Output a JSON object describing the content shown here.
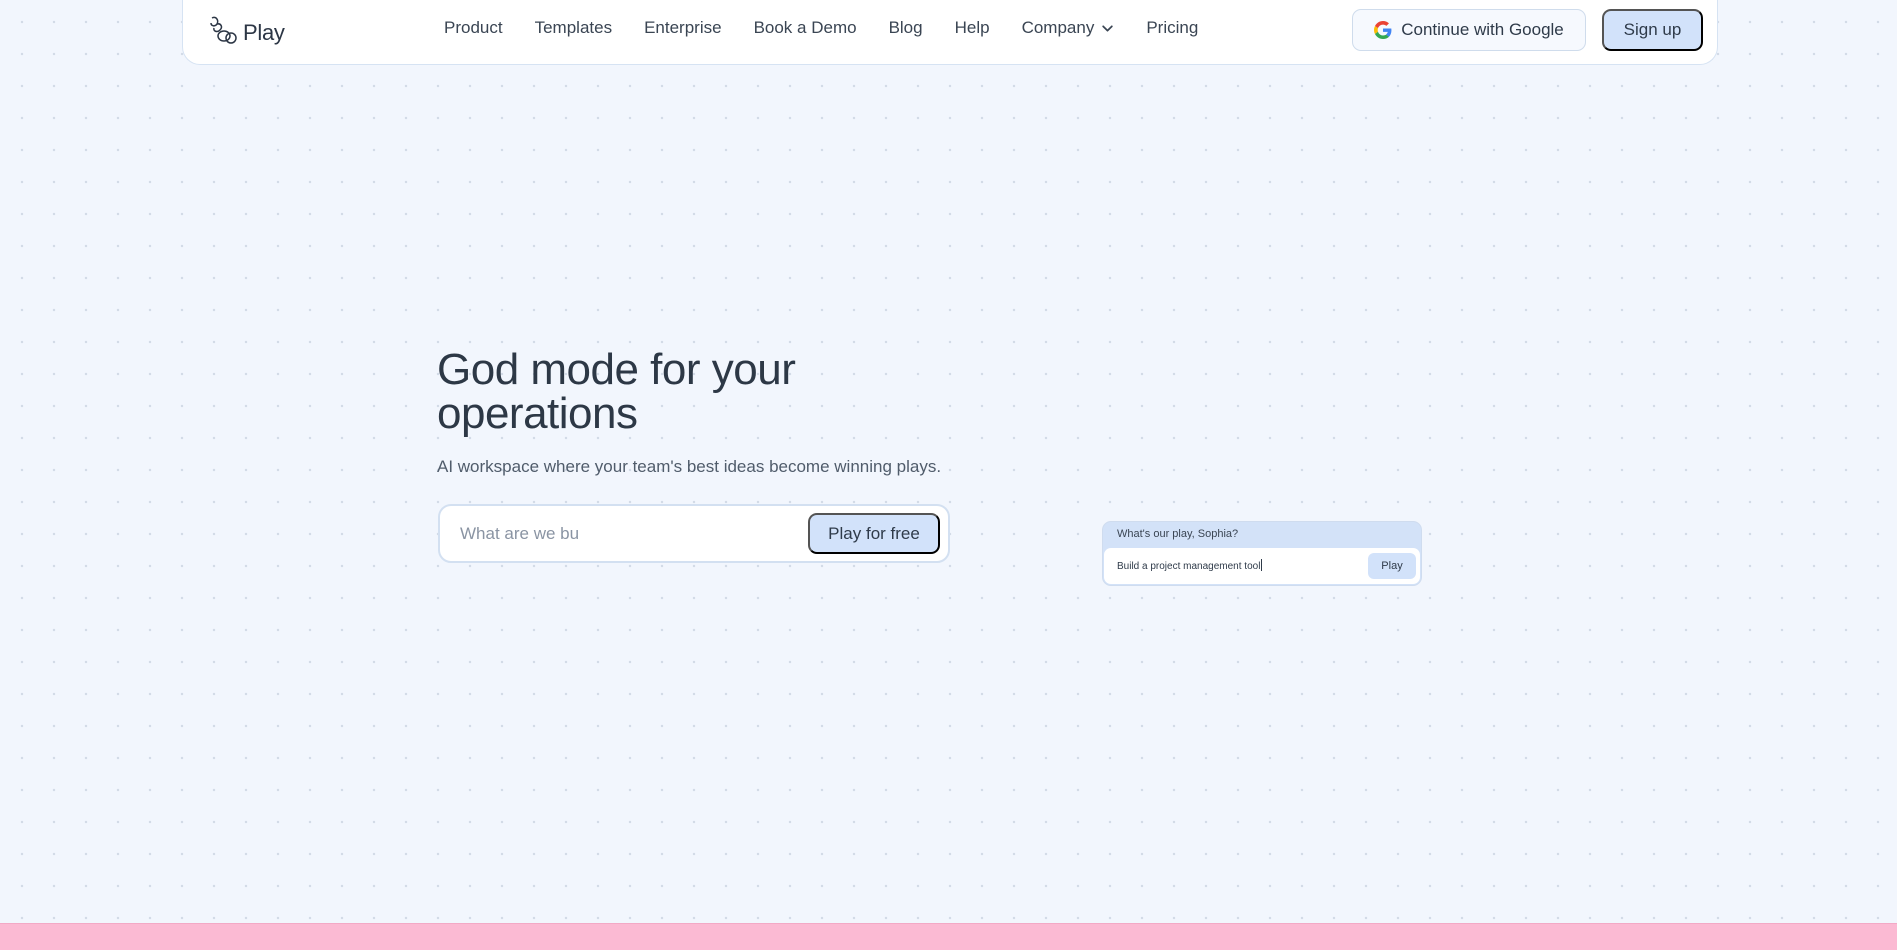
{
  "nav": {
    "brand": "Play",
    "links": [
      {
        "label": "Product"
      },
      {
        "label": "Templates"
      },
      {
        "label": "Enterprise"
      },
      {
        "label": "Book a Demo"
      },
      {
        "label": "Blog"
      },
      {
        "label": "Help"
      },
      {
        "label": "Company",
        "has_dropdown": true
      },
      {
        "label": "Pricing"
      }
    ],
    "google_button": "Continue with Google",
    "signup_button": "Sign up"
  },
  "hero": {
    "title": "God mode for your operations",
    "subtitle": "AI workspace where your team's best ideas become winning plays.",
    "input_value": "",
    "input_placeholder": "What are we bu",
    "cta": "Play for free"
  },
  "demo_card": {
    "prompt": "What's our play, Sophia?",
    "input_text": "Build a project management tool",
    "button": "Play"
  },
  "colors": {
    "background": "#f2f6fd",
    "accent_button": "#d2e2fa",
    "bottom_band": "#fbbad3",
    "text": "#2f3b4a"
  },
  "icons": {
    "brand": "play-logo-icon",
    "google": "google-g-icon",
    "dropdown": "chevron-down-icon"
  }
}
